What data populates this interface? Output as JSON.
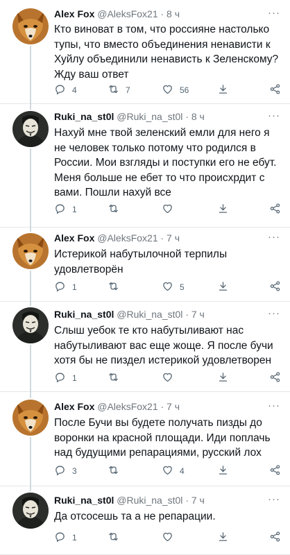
{
  "tweets": [
    {
      "author": "Alex Fox",
      "handle": "@AleksFox21",
      "time": "· 8 ч",
      "text": "Кто виноват в том, что россияне настолько тупы, что вместо объединения ненависти к Хуйлу объединили ненависть к Зеленскому? Жду ваш ответ",
      "replies": "4",
      "retweets": "7",
      "likes": "56",
      "avatar": "fox-avatar"
    },
    {
      "author": "Ruki_na_st0l",
      "handle": "@Ruki_na_st0l",
      "time": "· 8 ч",
      "text": "Нахуй мне твой зеленский емли для него я не человек только потому что родился в России. Мои взгляды и поступки его не ебут. Меня больше не ебет то что происхрдит с вами. Пошли нахуй все",
      "replies": "1",
      "retweets": "",
      "likes": "",
      "avatar": "mask-avatar"
    },
    {
      "author": "Alex Fox",
      "handle": "@AleksFox21",
      "time": "· 7 ч",
      "text": "Истерикой набутылочной терпилы удовлетворён",
      "replies": "1",
      "retweets": "",
      "likes": "5",
      "avatar": "fox-avatar"
    },
    {
      "author": "Ruki_na_st0l",
      "handle": "@Ruki_na_st0l",
      "time": "· 7 ч",
      "text": "Слыш уебок те кто набутыливают нас набутыливают вас еще жоще. Я после бучи хотя бы не пиздел истерикой удовлетворен",
      "replies": "1",
      "retweets": "",
      "likes": "",
      "avatar": "mask-avatar"
    },
    {
      "author": "Alex Fox",
      "handle": "@AleksFox21",
      "time": "· 7 ч",
      "text": "После Бучи вы будете получать пизды до воронки на красной площади. Иди поплачь над будущими репарациями, русский лох",
      "replies": "3",
      "retweets": "",
      "likes": "4",
      "avatar": "fox-avatar"
    },
    {
      "author": "Ruki_na_st0l",
      "handle": "@Ruki_na_st0l",
      "time": "· 7 ч",
      "text": "Да отсосешь та а не репарации.",
      "replies": "1",
      "retweets": "",
      "likes": "",
      "avatar": "mask-avatar"
    }
  ],
  "more_label": "···",
  "colors": {
    "text": "#0f1419",
    "secondary": "#536471",
    "divider": "#e6e6e6",
    "thread": "#cfd9de"
  }
}
